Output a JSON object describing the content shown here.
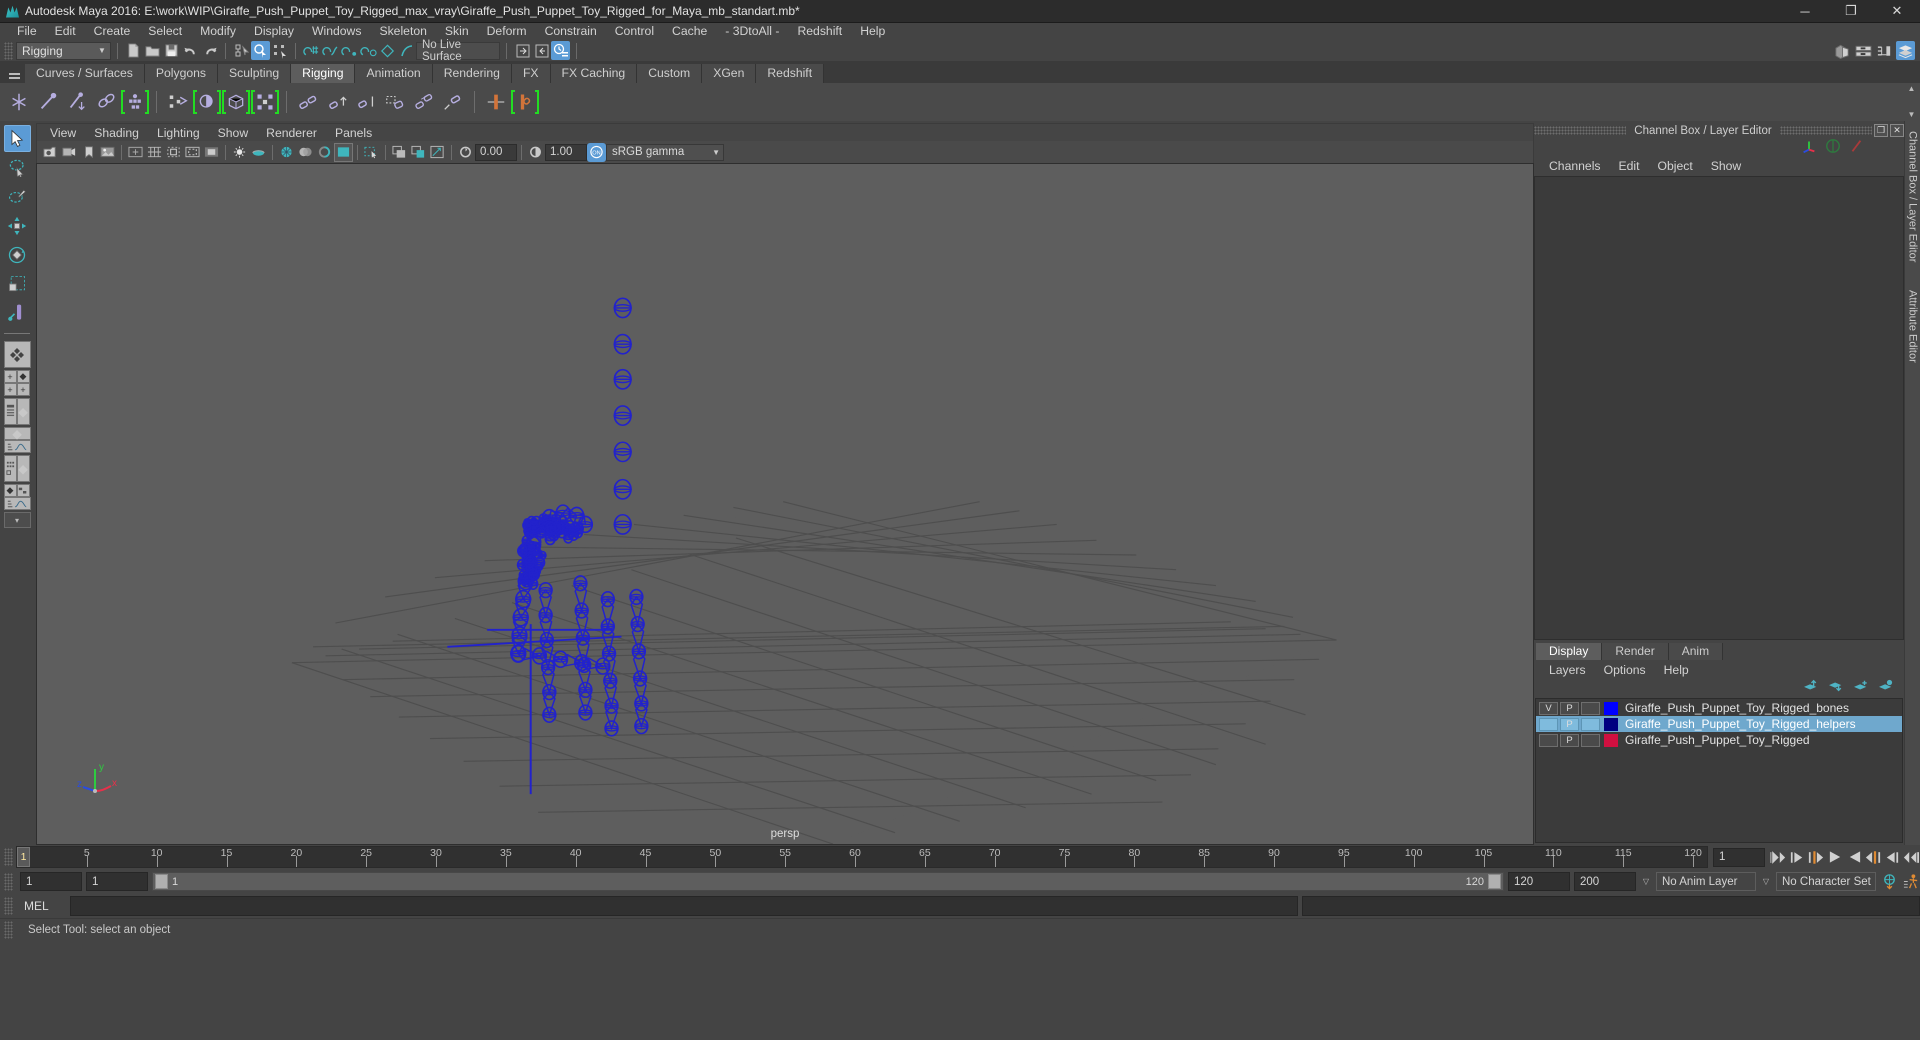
{
  "window": {
    "title": "Autodesk Maya 2016: E:\\work\\WIP\\Giraffe_Push_Puppet_Toy_Rigged_max_vray\\Giraffe_Push_Puppet_Toy_Rigged_for_Maya_mb_standart.mb*",
    "minimize": "─",
    "maximize": "❐",
    "close": "✕"
  },
  "menubar": {
    "items": [
      "File",
      "Edit",
      "Create",
      "Select",
      "Modify",
      "Display",
      "Windows",
      "Skeleton",
      "Skin",
      "Deform",
      "Constrain",
      "Control",
      "Cache",
      "- 3DtoAll -",
      "Redshift",
      "Help"
    ]
  },
  "statusline": {
    "menu_set": "Rigging",
    "live_surface": "No Live Surface",
    "dropdown_arrow": "▼"
  },
  "shelf": {
    "tabs": [
      "Curves / Surfaces",
      "Polygons",
      "Sculpting",
      "Rigging",
      "Animation",
      "Rendering",
      "FX",
      "FX Caching",
      "Custom",
      "XGen",
      "Redshift"
    ],
    "active_tab": "Rigging"
  },
  "viewport": {
    "menu": [
      "View",
      "Shading",
      "Lighting",
      "Show",
      "Renderer",
      "Panels"
    ],
    "exposure": "0.00",
    "gamma_value": "1.00",
    "color_profile": "sRGB gamma",
    "camera_label": "persp",
    "axis_x": "x",
    "axis_y": "y",
    "axis_z": "z",
    "bg_color": "#5e5e5e",
    "joint_color": "#2222cc"
  },
  "channelbox": {
    "title": "Channel Box / Layer Editor",
    "menu": [
      "Channels",
      "Edit",
      "Object",
      "Show"
    ],
    "restore": "❐",
    "close": "✕"
  },
  "layer_editor": {
    "tabs": [
      "Display",
      "Render",
      "Anim"
    ],
    "active_tab": "Display",
    "menu": [
      "Layers",
      "Options",
      "Help"
    ],
    "layers": [
      {
        "v": "V",
        "p": "P",
        "third": "",
        "color": "#0000ff",
        "name": "Giraffe_Push_Puppet_Toy_Rigged_bones",
        "selected": false
      },
      {
        "v": "",
        "p": "P",
        "third": "",
        "color": "#000080",
        "name": "Giraffe_Push_Puppet_Toy_Rigged_helpers",
        "selected": true
      },
      {
        "v": "",
        "p": "P",
        "third": "",
        "color": "#d01040",
        "name": "Giraffe_Push_Puppet_Toy_Rigged",
        "selected": false
      }
    ]
  },
  "right_sidebar": {
    "labels": [
      "Channel Box / Layer Editor",
      "Attribute Editor"
    ]
  },
  "timeline": {
    "current_frame": "1",
    "tick_labels": [
      "5",
      "10",
      "15",
      "20",
      "25",
      "30",
      "35",
      "40",
      "45",
      "50",
      "55",
      "60",
      "65",
      "70",
      "75",
      "80",
      "85",
      "90",
      "95",
      "100",
      "105",
      "110",
      "115",
      "120"
    ],
    "tick_values": [
      5,
      10,
      15,
      20,
      25,
      30,
      35,
      40,
      45,
      50,
      55,
      60,
      65,
      70,
      75,
      80,
      85,
      90,
      95,
      100,
      105,
      110,
      115,
      120
    ],
    "range_start": 1,
    "range_end": 120,
    "frame_field": "1"
  },
  "range_slider": {
    "anim_start": "1",
    "range_start": "1",
    "range_start_label": "1",
    "range_end_label": "120",
    "range_end": "120",
    "anim_end": "200",
    "anim_layer": "No Anim Layer",
    "character_set": "No Character Set",
    "dropdown_arrow": "▽"
  },
  "command_line": {
    "language": "MEL",
    "value": "",
    "placeholder": ""
  },
  "help_line": {
    "text": "Select Tool: select an object"
  }
}
